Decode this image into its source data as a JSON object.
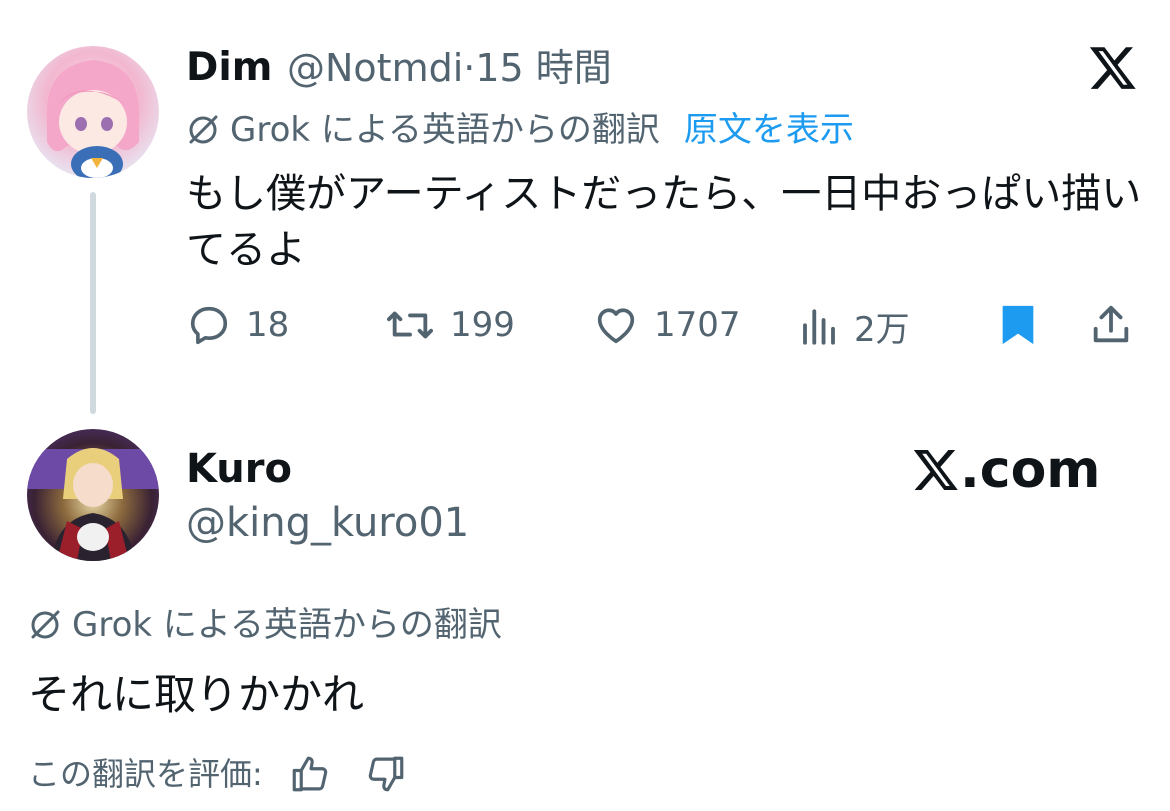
{
  "tweet1": {
    "display_name": "Dim",
    "handle": "@Notmdi",
    "separator": "·",
    "time": "15 時間",
    "translation_label": "Grok による英語からの翻訳",
    "show_original": "原文を表示",
    "text": "もし僕がアーティストだったら、一日中おっぱい描いてるよ",
    "stats": {
      "replies": "18",
      "retweets": "199",
      "likes": "1707",
      "views": "2万"
    }
  },
  "tweet2": {
    "display_name": "Kuro",
    "handle": "@king_kuro01",
    "translation_label": "Grok による英語からの翻訳",
    "text": "それに取りかかれ",
    "rate_label": "この翻訳を評価:"
  },
  "brand": {
    "x_logo": "x-logo-icon",
    "domain": ".com"
  },
  "colors": {
    "text": "#0f1419",
    "muted": "#536471",
    "link": "#1d9bf0",
    "thread_line": "#cfd9de"
  }
}
